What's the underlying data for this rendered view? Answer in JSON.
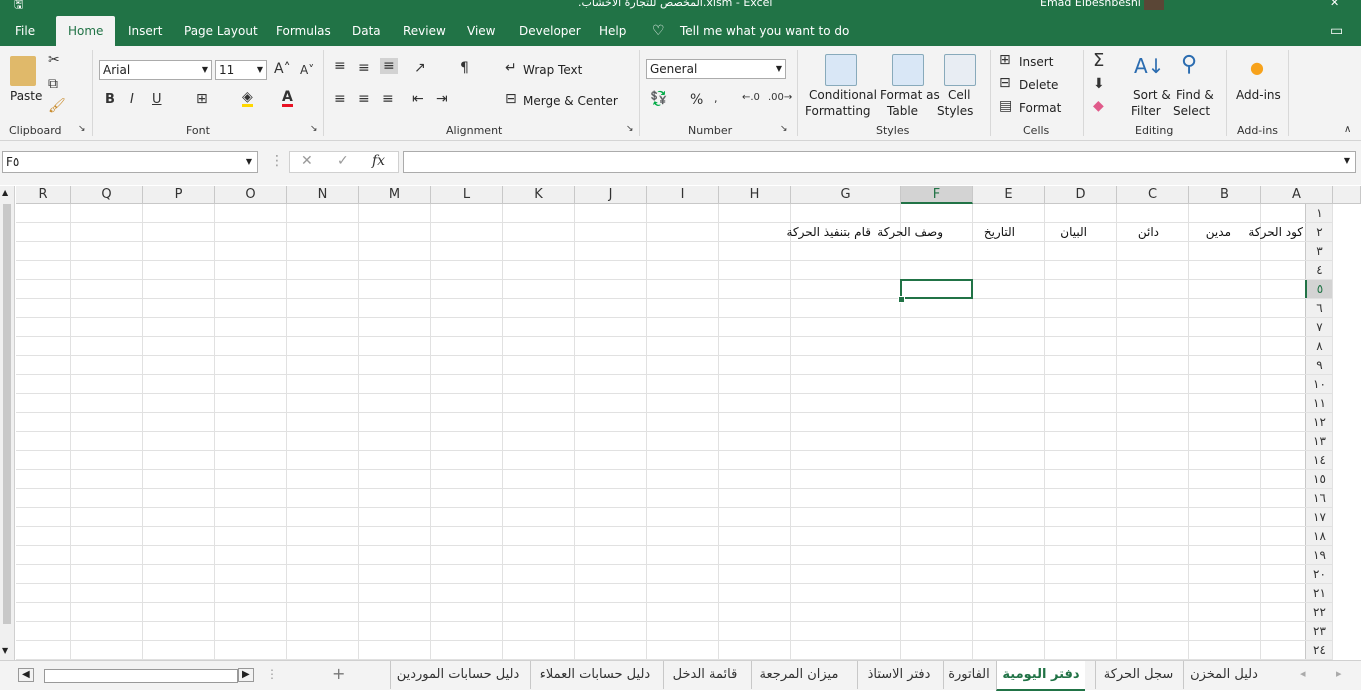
{
  "window": {
    "title": ".المخصص للتجارة الاخشاب.xlsm - Excel",
    "user": "Emad Elbeshbeshi"
  },
  "menu": {
    "tabs": [
      "File",
      "Home",
      "Insert",
      "Page Layout",
      "Formulas",
      "Data",
      "Review",
      "View",
      "Developer",
      "Help"
    ],
    "active": "Home",
    "tell_me": "Tell me what you want to do"
  },
  "ribbon": {
    "clipboard": {
      "paste": "Paste",
      "label": "Clipboard"
    },
    "font": {
      "name": "Arial",
      "size": "11",
      "label": "Font",
      "bold": "B",
      "italic": "I",
      "underline": "U"
    },
    "alignment": {
      "wrap": "Wrap Text",
      "merge": "Merge & Center",
      "label": "Alignment"
    },
    "number": {
      "format": "General",
      "percent": "%",
      "label": "Number"
    },
    "styles": {
      "conditional_1": "Conditional",
      "conditional_2": "Formatting",
      "format_table_1": "Format as",
      "format_table_2": "Table",
      "cell_styles_1": "Cell",
      "cell_styles_2": "Styles",
      "label": "Styles"
    },
    "cells": {
      "insert": "Insert",
      "delete": "Delete",
      "format": "Format",
      "label": "Cells"
    },
    "editing": {
      "sort_1": "Sort &",
      "sort_2": "Filter",
      "find_1": "Find &",
      "find_2": "Select",
      "label": "Editing"
    },
    "addins": {
      "button": "Add-ins",
      "label": "Add-ins"
    }
  },
  "formula_bar": {
    "name_box": "F٥",
    "fx": "fx",
    "formula": ""
  },
  "grid": {
    "columns": [
      "R",
      "Q",
      "P",
      "O",
      "N",
      "M",
      "L",
      "K",
      "J",
      "I",
      "H",
      "G",
      "F",
      "E",
      "D",
      "C",
      "B",
      "A"
    ],
    "rows": [
      "١",
      "٢",
      "٣",
      "٤",
      "٥",
      "٦",
      "٧",
      "٨",
      "٩",
      "١٠",
      "١١",
      "١٢",
      "١٣",
      "١٤",
      "١٥",
      "١٦",
      "١٧",
      "١٨",
      "١٩",
      "٢٠",
      "٢١",
      "٢٢",
      "٢٣",
      "٢٤"
    ],
    "selected_cell": "F5",
    "row2": {
      "A": "كود الحركة",
      "B": "مدين",
      "C": "دائن",
      "D": "البيان",
      "E": "التاريخ",
      "F": "وصف الحركة",
      "G": "قام بتنفيذ الحركة"
    }
  },
  "sheets": {
    "tabs": [
      "دليل المخزن",
      "سجل الحركة",
      "دفتر اليومية",
      "الفاتورة",
      "دفتر الاستاذ",
      "ميزان المرجعة",
      "قائمة الدخل",
      "دليل حسابات العملاء",
      "دليل حسابات الموردين"
    ],
    "active": "دفتر اليومية",
    "add": "+"
  },
  "colors": {
    "accent": "#217346",
    "ribbon": "#f3f3f3",
    "gridline": "#e1e1e1"
  }
}
